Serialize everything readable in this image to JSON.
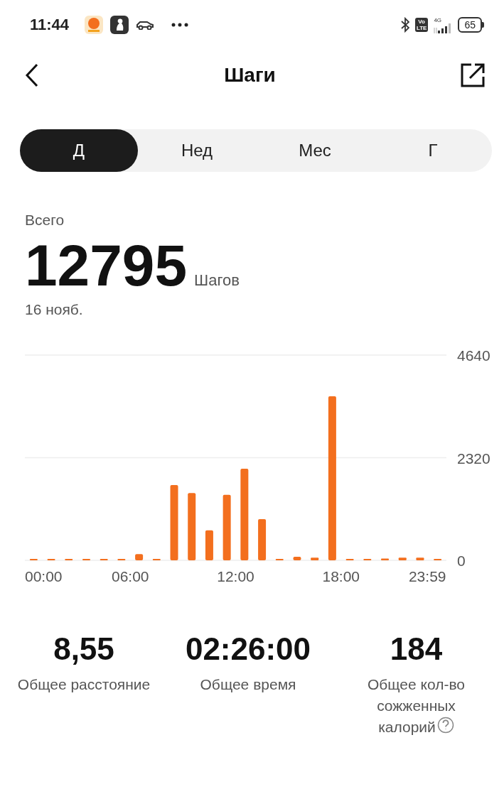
{
  "status_bar": {
    "time": "11:44",
    "volte_top": "Vo",
    "volte_bottom": "LTE",
    "network": "4G",
    "battery": "65"
  },
  "header": {
    "title": "Шаги"
  },
  "tabs": [
    {
      "label": "Д",
      "selected": true
    },
    {
      "label": "Нед",
      "selected": false
    },
    {
      "label": "Мес",
      "selected": false
    },
    {
      "label": "Г",
      "selected": false
    }
  ],
  "summary": {
    "label": "Всего",
    "value": "12795",
    "unit": "Шагов",
    "date": "16 нояб."
  },
  "chart_data": {
    "type": "bar",
    "x": [
      0.5,
      1.5,
      2.5,
      3.5,
      4.5,
      5.5,
      6.5,
      7.5,
      8.5,
      9.5,
      10.5,
      11.5,
      12.5,
      13.5,
      14.5,
      15.5,
      16.5,
      17.5,
      18.5,
      19.5,
      20.5,
      21.5,
      22.5,
      23.5
    ],
    "values": [
      0,
      0,
      0,
      0,
      0,
      0,
      140,
      30,
      1700,
      1520,
      680,
      1480,
      2070,
      930,
      20,
      80,
      60,
      3710,
      20,
      10,
      40,
      60,
      60,
      30
    ],
    "xlim": [
      0,
      24
    ],
    "ylim": [
      0,
      4640
    ],
    "yticks": [
      0,
      2320,
      4640
    ],
    "xticks": [
      {
        "value": 0,
        "label": "00:00"
      },
      {
        "value": 6,
        "label": "06:00"
      },
      {
        "value": 12,
        "label": "12:00"
      },
      {
        "value": 18,
        "label": "18:00"
      },
      {
        "value": 23.98,
        "label": "23:59"
      }
    ]
  },
  "stats": [
    {
      "value": "8,55",
      "label": "Общее расстояние",
      "help": false
    },
    {
      "value": "02:26:00",
      "label": "Общее время",
      "help": false
    },
    {
      "value": "184",
      "label": "Общее кол-во сожженных калорий",
      "help": true
    }
  ]
}
